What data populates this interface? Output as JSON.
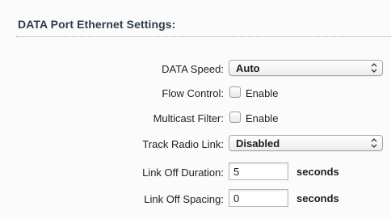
{
  "section": {
    "title": "DATA Port Ethernet Settings:"
  },
  "fields": {
    "data_speed": {
      "label": "DATA Speed:",
      "value": "Auto"
    },
    "flow_control": {
      "label": "Flow Control:",
      "option": "Enable",
      "checked": false
    },
    "multicast_filter": {
      "label": "Multicast Filter:",
      "option": "Enable",
      "checked": false
    },
    "track_radio_link": {
      "label": "Track Radio Link:",
      "value": "Disabled"
    },
    "link_off_duration": {
      "label": "Link Off Duration:",
      "value": "5",
      "unit": "seconds"
    },
    "link_off_spacing": {
      "label": "Link Off Spacing:",
      "value": "0",
      "unit": "seconds"
    }
  },
  "icons": {
    "select_arrow": "updown-chevron-icon"
  }
}
